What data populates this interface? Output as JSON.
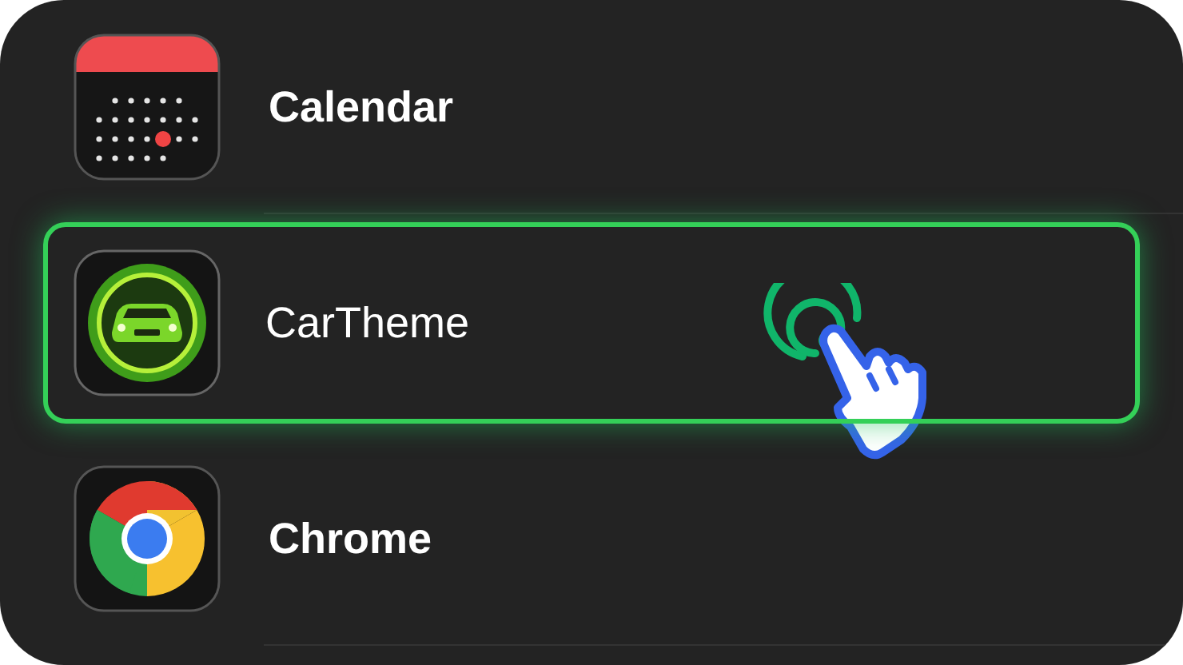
{
  "apps": [
    {
      "name": "Calendar",
      "kind": "calendar",
      "selected": false
    },
    {
      "name": "CarTheme",
      "kind": "car",
      "selected": true
    },
    {
      "name": "Chrome",
      "kind": "chrome",
      "selected": false
    }
  ]
}
